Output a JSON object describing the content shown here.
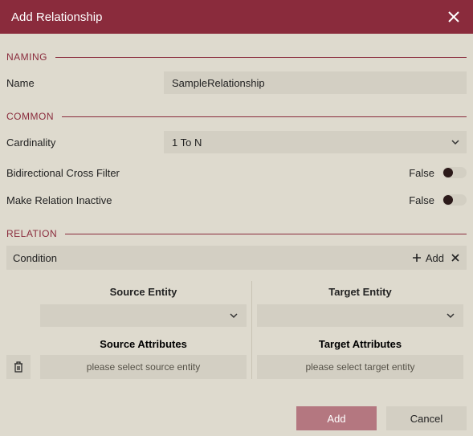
{
  "titlebar": {
    "title": "Add Relationship"
  },
  "sections": {
    "naming": {
      "header": "NAMING",
      "name_label": "Name",
      "name_value": "SampleRelationship"
    },
    "common": {
      "header": "COMMON",
      "cardinality_label": "Cardinality",
      "cardinality_value": "1 To N",
      "bidi_label": "Bidirectional Cross Filter",
      "bidi_state": "False",
      "inactive_label": "Make Relation Inactive",
      "inactive_state": "False"
    },
    "relation": {
      "header": "RELATION",
      "condition_label": "Condition",
      "add_label": "Add",
      "source_entity_label": "Source Entity",
      "target_entity_label": "Target Entity",
      "source_attr_label": "Source Attributes",
      "target_attr_label": "Target Attributes",
      "source_placeholder": "please select source entity",
      "target_placeholder": "please select target entity"
    }
  },
  "footer": {
    "add": "Add",
    "cancel": "Cancel"
  }
}
